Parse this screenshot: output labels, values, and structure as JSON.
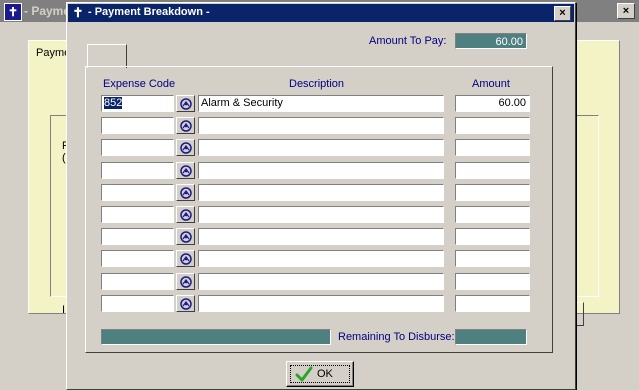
{
  "background_window": {
    "title": "- Payme",
    "tab_label": "Payme",
    "frag_left_1": "F",
    "frag_left_2": "(",
    "frag_left_3": "I",
    "close_glyph": "×"
  },
  "dialog": {
    "title": "- Payment Breakdown -",
    "close_glyph": "×",
    "amount_to_pay_label": "Amount To Pay:",
    "amount_to_pay_value": "60.00",
    "columns": {
      "expense_code": "Expense Code",
      "description": "Description",
      "amount": "Amount"
    },
    "rows": [
      {
        "code": "852",
        "description": "Alarm & Security",
        "amount": "60.00"
      },
      {
        "code": "",
        "description": "",
        "amount": ""
      },
      {
        "code": "",
        "description": "",
        "amount": ""
      },
      {
        "code": "",
        "description": "",
        "amount": ""
      },
      {
        "code": "",
        "description": "",
        "amount": ""
      },
      {
        "code": "",
        "description": "",
        "amount": ""
      },
      {
        "code": "",
        "description": "",
        "amount": ""
      },
      {
        "code": "",
        "description": "",
        "amount": ""
      },
      {
        "code": "",
        "description": "",
        "amount": ""
      },
      {
        "code": "",
        "description": "",
        "amount": ""
      }
    ],
    "remaining_label": "Remaining To Disburse:",
    "remaining_value": "",
    "ok_label": "OK",
    "icons": {
      "title": "app-logo-icon",
      "lookup": "lookup-icon",
      "ok": "checkmark-icon"
    },
    "colors": {
      "titlebar": "#0a246a",
      "value_field": "#4f8080",
      "label_text": "#000080",
      "checkmark": "#2aa52a"
    }
  }
}
